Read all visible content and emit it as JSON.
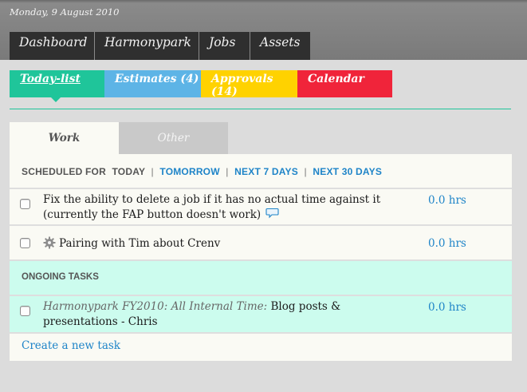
{
  "header": {
    "date": "Monday, 9 August 2010"
  },
  "nav": {
    "items": [
      {
        "label": "Dashboard"
      },
      {
        "label": "Harmonypark"
      },
      {
        "label": "Jobs"
      },
      {
        "label": "Assets"
      }
    ]
  },
  "subtabs": {
    "items": [
      {
        "label": "Today-list",
        "color": "#1fc59a"
      },
      {
        "label": "Estimates (4)",
        "color": "#5db4e6"
      },
      {
        "label": "Approvals (14)",
        "color": "#ffd200"
      },
      {
        "label": "Calendar",
        "color": "#f0243a"
      }
    ]
  },
  "panel_tabs": {
    "work": "Work",
    "other": "Other"
  },
  "scheduled": {
    "label": "SCHEDULED FOR",
    "today": "TODAY",
    "separator": "|",
    "tomorrow": "TOMORROW",
    "next7": "NEXT 7 DAYS",
    "next30": "NEXT 30 DAYS"
  },
  "tasks": [
    {
      "text": "Fix the ability to delete a job if it has no actual time against it (currently the FAP button doesn't work)",
      "hours": "0.0 hrs",
      "icon": "comment-icon"
    },
    {
      "text": "Pairing with Tim about Crenv",
      "hours": "0.0 hrs",
      "icon": "gear-icon"
    }
  ],
  "ongoing": {
    "title": "ONGOING TASKS",
    "tasks": [
      {
        "project": "Harmonypark FY2010: All Internal Time:",
        "text": "Blog posts & presentations - Chris",
        "hours": "0.0 hrs"
      }
    ]
  },
  "create_task": "Create a new task"
}
